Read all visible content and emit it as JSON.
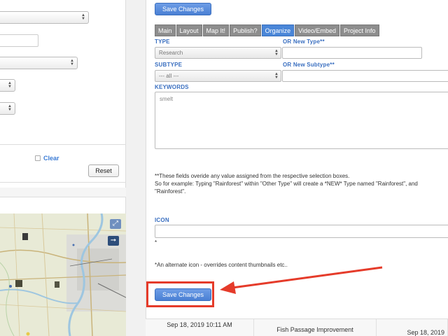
{
  "left_panel": {
    "clear_label": "Clear",
    "reset_label": "Reset"
  },
  "map": {
    "expand_icon": "expand-icon",
    "arrow_icon": "arrow-right-icon"
  },
  "form": {
    "save_top_label": "Save Changes",
    "tabs": [
      {
        "label": "Main",
        "active": false
      },
      {
        "label": "Layout",
        "active": false
      },
      {
        "label": "Map It!",
        "active": false
      },
      {
        "label": "Publish?",
        "active": false
      },
      {
        "label": "Organize",
        "active": true
      },
      {
        "label": "Video/Embed",
        "active": false
      },
      {
        "label": "Project Info",
        "active": false
      }
    ],
    "type_label": "TYPE",
    "type_value": "Research",
    "new_type_label": "OR New Type**",
    "subtype_label": "SUBTYPE",
    "subtype_value": "--- all ---",
    "new_subtype_label": "OR New Subtype**",
    "keywords_label": "KEYWORDS",
    "keywords_value": "smelt",
    "override_note_1": "**These fields overide any value assigned from the respective selection boxes.",
    "override_note_2": "So for example: Typing \"Rainforest\" within \"Other Type\" will create a *NEW* Type named \"Rainforest\", and",
    "override_note_3": "\"Rainforest\".",
    "icon_label": "ICON",
    "icon_asterisk": "*",
    "icon_note": "*An alternate icon - overrides content thumbnails etc..",
    "save_bottom_label": "Save Changes"
  },
  "table_row": {
    "date_1": "Sep 18, 2019 10:11 AM",
    "title": "Fish Passage Improvement",
    "date_2": "Sep 18, 2019"
  },
  "colors": {
    "accent_blue": "#4a86d8",
    "tab_gray": "#8d8d8d",
    "highlight_red": "#e53b2a"
  }
}
